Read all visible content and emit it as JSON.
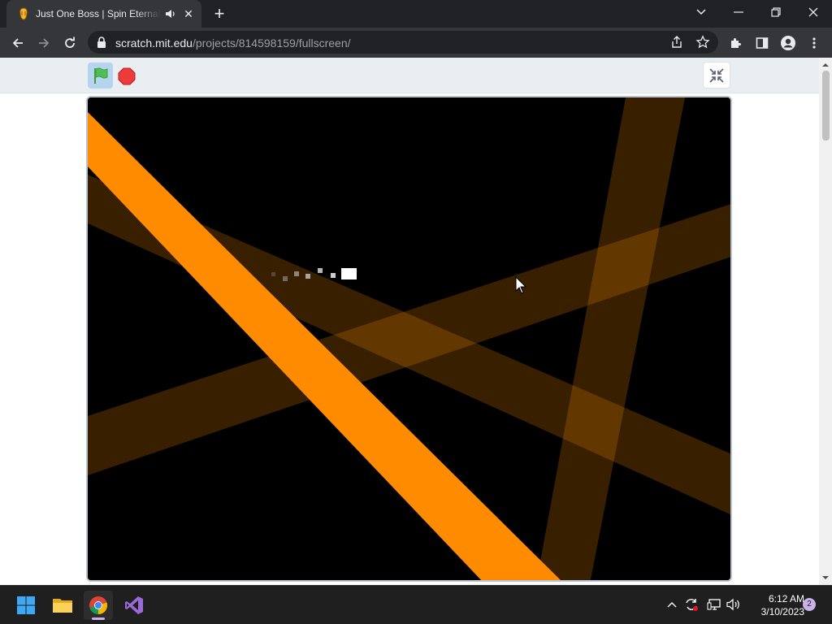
{
  "browser": {
    "tab_title": "Just One Boss | Spin Eternally",
    "url_host": "scratch.mit.edu",
    "url_path": "/projects/814598159/fullscreen/"
  },
  "icons": {
    "tab_favicon": "scratch-cat-icon",
    "tab_audio": "speaker-icon",
    "tab_close": "close-icon",
    "new_tab": "plus-icon",
    "minimize": "minimize-icon",
    "restore": "restore-icon",
    "close_window": "close-icon",
    "back": "back-arrow-icon",
    "forward": "forward-arrow-icon",
    "reload": "reload-icon",
    "lock": "lock-icon",
    "share": "share-icon",
    "bookmark": "star-icon",
    "extensions": "puzzle-icon",
    "side_panel": "side-panel-icon",
    "profile": "profile-icon",
    "menu": "kebab-menu-icon",
    "green_flag": "green-flag-icon",
    "stop": "stop-sign-icon",
    "exit_fullscreen": "exit-fullscreen-icon"
  },
  "taskbar": {
    "time": "6:12 AM",
    "date": "3/10/2023",
    "notifications": "2",
    "apps": [
      "start-icon",
      "file-explorer-icon",
      "chrome-icon",
      "visual-studio-icon"
    ]
  },
  "colors": {
    "beam": "#ff8c00",
    "beam_faded": "#7a3d00",
    "flag_bg": "#b5d5ef",
    "stop": "#ec3b3b"
  }
}
